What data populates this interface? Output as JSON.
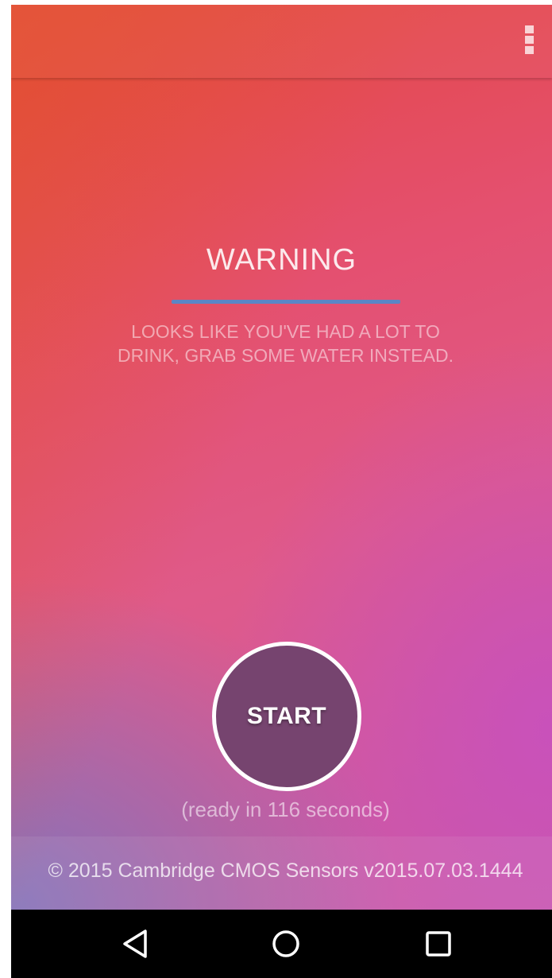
{
  "appbar": {
    "menu_icon": "more-vertical-icon"
  },
  "warning": {
    "title": "WARNING",
    "message": "LOOKS LIKE YOU'VE HAD A LOT TO DRINK, GRAB SOME WATER INSTEAD.",
    "rule_color": "#5b86c6"
  },
  "start_button": {
    "label": "START",
    "fill_color": "#76446f",
    "border_color": "#ffffff"
  },
  "status": {
    "ready_text": "(ready in 116 seconds)"
  },
  "footer": {
    "copyright": "© 2015 Cambridge CMOS Sensors v2015.07.03.1444"
  },
  "navigation_bar": {
    "back_icon": "back-triangle-icon",
    "home_icon": "home-circle-icon",
    "recents_icon": "recents-square-icon"
  },
  "colors": {
    "background_top": "#e4463a",
    "background_bottom": "#c85aa6",
    "nav_bar": "#000000"
  }
}
